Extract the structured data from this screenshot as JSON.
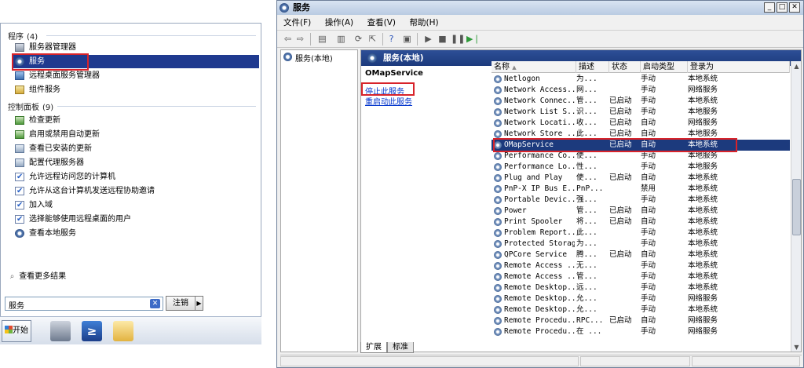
{
  "start_menu": {
    "programs_header": "程序",
    "programs_count": "(4)",
    "programs": [
      {
        "label": "服务器管理器",
        "icon": "server-manager-icon"
      },
      {
        "label": "服务",
        "icon": "services-gear-icon",
        "selected": true
      },
      {
        "label": "远程桌面服务管理器",
        "icon": "remote-desktop-icon"
      },
      {
        "label": "组件服务",
        "icon": "component-services-icon"
      }
    ],
    "control_panel_header": "控制面板",
    "control_panel_count": "(9)",
    "control_panel": [
      {
        "label": "检查更新",
        "icon": "windows-update-icon"
      },
      {
        "label": "启用或禁用自动更新",
        "icon": "windows-update-icon"
      },
      {
        "label": "查看已安装的更新",
        "icon": "installed-updates-icon"
      },
      {
        "label": "配置代理服务器",
        "icon": "proxy-icon"
      },
      {
        "label": "允许远程访问您的计算机",
        "icon": "checkbox-icon"
      },
      {
        "label": "允许从这台计算机发送远程协助邀请",
        "icon": "checkbox-icon"
      },
      {
        "label": "加入域",
        "icon": "checkbox-icon"
      },
      {
        "label": "选择能够使用远程桌面的用户",
        "icon": "checkbox-icon"
      },
      {
        "label": "查看本地服务",
        "icon": "services-gear-icon"
      }
    ],
    "see_more": "查看更多结果",
    "search_value": "服务",
    "logoff_label": "注销",
    "start_label": "开始"
  },
  "services_window": {
    "title": "服务",
    "menu": [
      "文件(F)",
      "操作(A)",
      "查看(V)",
      "帮助(H)"
    ],
    "tree_item": "服务(本地)",
    "pane_title": "服务(本地)",
    "selected_service": "OMapService",
    "action_stop": "停止此服务",
    "action_restart": "重启动此服务",
    "columns": [
      "名称",
      "描述",
      "状态",
      "启动类型",
      "登录为"
    ],
    "rows": [
      [
        "Netlogon",
        "为...",
        "",
        "手动",
        "本地系统"
      ],
      [
        "Network Access...",
        "网...",
        "",
        "手动",
        "网络服务"
      ],
      [
        "Network Connec...",
        "管...",
        "已启动",
        "手动",
        "本地系统"
      ],
      [
        "Network List S...",
        "识...",
        "已启动",
        "手动",
        "本地服务"
      ],
      [
        "Network Locati...",
        "收...",
        "已启动",
        "自动",
        "网络服务"
      ],
      [
        "Network Store ...",
        "此...",
        "已启动",
        "自动",
        "本地服务"
      ],
      [
        "OMapService",
        "",
        "已启动",
        "自动",
        "本地系统"
      ],
      [
        "Performance Co...",
        "使...",
        "",
        "手动",
        "本地服务"
      ],
      [
        "Performance Lo...",
        "性...",
        "",
        "手动",
        "本地服务"
      ],
      [
        "Plug and Play",
        "使...",
        "已启动",
        "自动",
        "本地系统"
      ],
      [
        "PnP-X IP Bus E...",
        "PnP...",
        "",
        "禁用",
        "本地系统"
      ],
      [
        "Portable Devic...",
        "强...",
        "",
        "手动",
        "本地系统"
      ],
      [
        "Power",
        "管...",
        "已启动",
        "自动",
        "本地系统"
      ],
      [
        "Print Spooler",
        "将...",
        "已启动",
        "自动",
        "本地系统"
      ],
      [
        "Problem Report...",
        "此...",
        "",
        "手动",
        "本地系统"
      ],
      [
        "Protected Storage",
        "为...",
        "",
        "手动",
        "本地系统"
      ],
      [
        "QPCore Service",
        "腾...",
        "已启动",
        "自动",
        "本地系统"
      ],
      [
        "Remote Access ...",
        "无...",
        "",
        "手动",
        "本地系统"
      ],
      [
        "Remote Access ...",
        "管...",
        "",
        "手动",
        "本地系统"
      ],
      [
        "Remote Desktop...",
        "远...",
        "",
        "手动",
        "本地系统"
      ],
      [
        "Remote Desktop...",
        "允...",
        "",
        "手动",
        "网络服务"
      ],
      [
        "Remote Desktop...",
        "允...",
        "",
        "手动",
        "本地系统"
      ],
      [
        "Remote Procedu...",
        "RPC...",
        "已启动",
        "自动",
        "网络服务"
      ],
      [
        "Remote Procedu...",
        "在 ...",
        "",
        "手动",
        "网络服务"
      ]
    ],
    "tabs": [
      "扩展",
      "标准"
    ],
    "active_tab": "扩展"
  },
  "colors": {
    "selection": "#1c3a7d",
    "highlight_box": "#d8232a",
    "link": "#0033cc"
  }
}
